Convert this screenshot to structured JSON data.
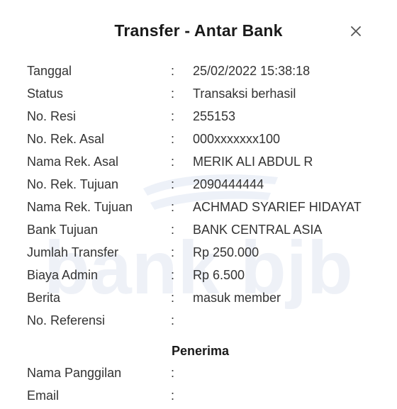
{
  "dialog": {
    "title": "Transfer - Antar Bank",
    "close_icon": "close-icon",
    "watermark_text": "bank bjb"
  },
  "details": [
    {
      "label": "Tanggal",
      "sep": ":",
      "value": "25/02/2022 15:38:18"
    },
    {
      "label": "Status",
      "sep": ":",
      "value": "Transaksi berhasil"
    },
    {
      "label": "No. Resi",
      "sep": ":",
      "value": "255153"
    },
    {
      "label": "No. Rek. Asal",
      "sep": ":",
      "value": "000xxxxxxx100"
    },
    {
      "label": "Nama Rek. Asal",
      "sep": ":",
      "value": "MERIK ALI ABDUL R"
    },
    {
      "label": "No. Rek. Tujuan",
      "sep": ":",
      "value": "2090444444"
    },
    {
      "label": "Nama Rek. Tujuan",
      "sep": ":",
      "value": "ACHMAD SYARIEF HIDAYAT"
    },
    {
      "label": "Bank Tujuan",
      "sep": ":",
      "value": "BANK CENTRAL ASIA"
    },
    {
      "label": "Jumlah Transfer",
      "sep": ":",
      "value": "Rp 250.000"
    },
    {
      "label": "Biaya Admin",
      "sep": ":",
      "value": "Rp 6.500"
    },
    {
      "label": "Berita",
      "sep": ":",
      "value": "masuk member"
    },
    {
      "label": "No. Referensi",
      "sep": ":",
      "value": ""
    }
  ],
  "penerima": {
    "header": "Penerima",
    "rows": [
      {
        "label": "Nama Panggilan",
        "sep": ":",
        "value": ""
      },
      {
        "label": "Email",
        "sep": ":",
        "value": ""
      }
    ]
  },
  "colors": {
    "title": "#1a1a1a",
    "text": "#333333",
    "watermark": "#eef1f7",
    "background": "#ffffff"
  }
}
